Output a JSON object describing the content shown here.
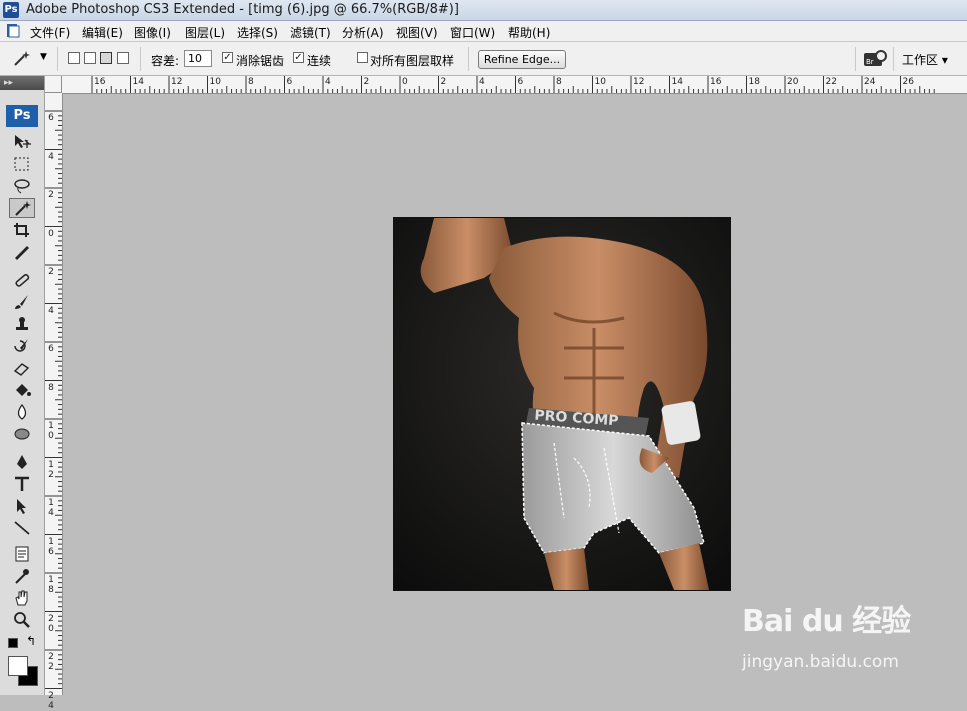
{
  "window": {
    "title": "Adobe Photoshop CS3 Extended - [timg (6).jpg @ 66.7%(RGB/8#)]",
    "app_badge": "Ps"
  },
  "menu": {
    "items": [
      "文件(F)",
      "编辑(E)",
      "图像(I)",
      "图层(L)",
      "选择(S)",
      "滤镜(T)",
      "分析(A)",
      "视图(V)",
      "窗口(W)",
      "帮助(H)"
    ]
  },
  "options": {
    "tolerance_label": "容差:",
    "tolerance_value": "10",
    "anti_alias_label": "消除锯齿",
    "anti_alias_checked": true,
    "contiguous_label": "连续",
    "contiguous_checked": true,
    "sample_all_layers_label": "对所有图层取样",
    "sample_all_layers_checked": false,
    "refine_edge_label": "Refine Edge...",
    "workspace_label": "工作区 ▾",
    "bridge_icon": "bridge-icon"
  },
  "toolbox": {
    "grip": "▸▸",
    "ps_logo": "Ps",
    "tools": [
      "move-tool",
      "marquee-tool",
      "lasso-tool",
      "magic-wand-tool",
      "crop-tool",
      "slice-tool",
      "healing-brush-tool",
      "brush-tool",
      "clone-stamp-tool",
      "history-brush-tool",
      "eraser-tool",
      "paint-bucket-tool",
      "blur-tool",
      "dodge-tool",
      "pen-tool",
      "type-tool",
      "path-selection-tool",
      "line-tool",
      "notes-tool",
      "eyedropper-tool",
      "hand-tool",
      "zoom-tool"
    ],
    "active_tool": "magic-wand-tool",
    "foreground_color": "#ffffff",
    "background_color": "#000000"
  },
  "rulers": {
    "top_labels": [
      "16",
      "14",
      "12",
      "10",
      "8",
      "6",
      "4",
      "2",
      "0",
      "2",
      "4",
      "6",
      "8",
      "10",
      "12",
      "14",
      "16",
      "18",
      "20",
      "22",
      "24",
      "26"
    ],
    "left_labels": [
      "6",
      "4",
      "2",
      "0",
      "2",
      "4",
      "6",
      "8",
      "10",
      "12",
      "14",
      "16",
      "18",
      "20",
      "22",
      "24"
    ]
  },
  "photo_text": "PRO COMP",
  "watermark": {
    "logo": "Bai du 经验",
    "url": "jingyan.baidu.com"
  }
}
